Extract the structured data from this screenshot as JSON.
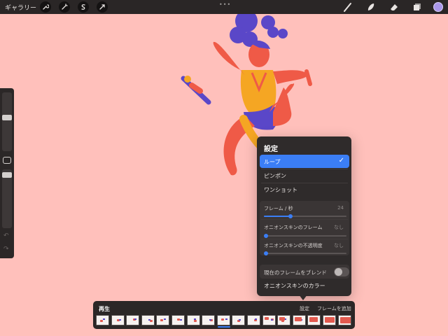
{
  "toolbar": {
    "gallery_label": "ギャラリー",
    "more_dots": "•••",
    "actions": [
      "wrench-icon",
      "adjustments-icon",
      "selection-icon",
      "transform-icon"
    ],
    "tools": [
      "brush-icon",
      "smudge-icon",
      "eraser-icon",
      "layers-icon"
    ],
    "current_color": "#a996e9"
  },
  "sidebar": {
    "brush_size_level": 0.7,
    "opacity_level": 0.3,
    "undo_icon": "undo-icon",
    "redo_icon": "redo-icon"
  },
  "settings": {
    "title": "設定",
    "options": [
      {
        "label": "ループ",
        "selected": true
      },
      {
        "label": "ピンポン",
        "selected": false
      },
      {
        "label": "ワンショット",
        "selected": false
      }
    ],
    "fps_label": "フレーム / 秒",
    "fps_value": "24",
    "fps_level": 0.32,
    "onion_frames_label": "オニオンスキンのフレーム",
    "onion_frames_value": "なし",
    "onion_opacity_label": "オニオンスキンの不透明度",
    "onion_opacity_value": "なし",
    "blend_label": "現在のフレームをブレンド",
    "blend_on": false,
    "onion_color_label": "オニオンスキンのカラー"
  },
  "timeline": {
    "play_label": "再生",
    "settings_label": "設定",
    "add_frame_label": "フレームを追加",
    "frame_count": 17
  },
  "colors": {
    "canvas": "#ffc0bb",
    "accent": "#3b7ef5",
    "character_skin": "#ef5a47",
    "character_hair": "#5a47c8",
    "character_outfit": "#f5a623"
  }
}
